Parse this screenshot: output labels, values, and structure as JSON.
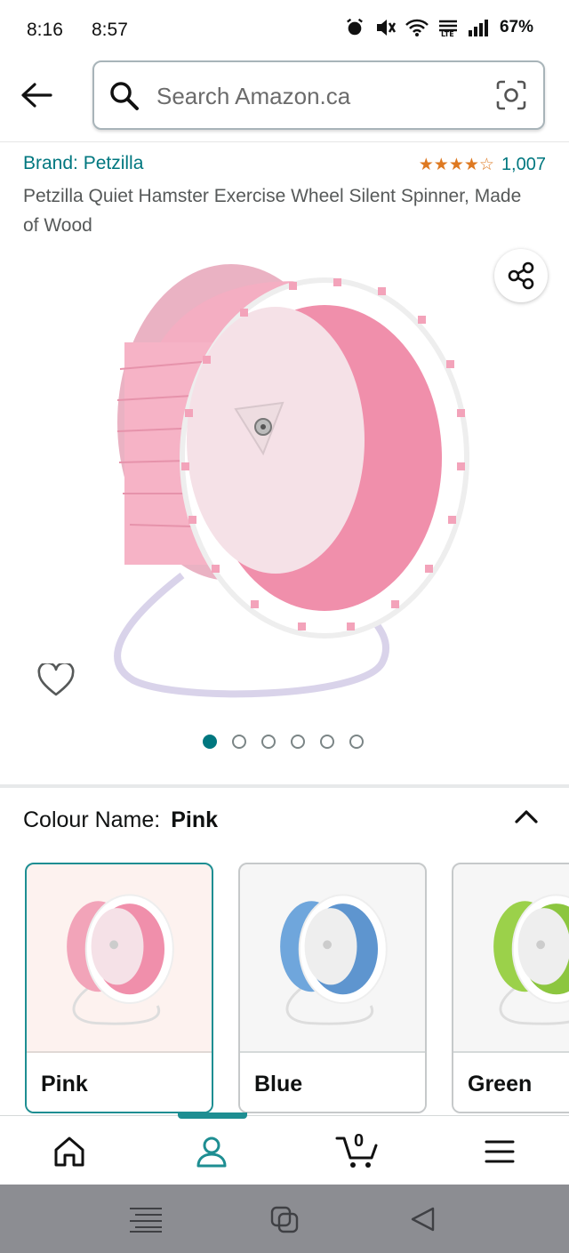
{
  "status_bar": {
    "time_primary": "8:16",
    "time_secondary": "8:57",
    "battery": "67%"
  },
  "search": {
    "placeholder": "Search Amazon.ca"
  },
  "product": {
    "brand": "Brand: Petzilla",
    "rating_stars": "★★★★☆",
    "rating_value": 4.5,
    "rating_count": "1,007",
    "title": "Petzilla Quiet Hamster Exercise Wheel Silent Spinner, Made of Wood",
    "image_count": 6,
    "active_image_index": 0
  },
  "colour": {
    "label": "Colour Name:",
    "selected": "Pink",
    "options": [
      {
        "label": "Pink",
        "color": "#f4a6bd"
      },
      {
        "label": "Blue",
        "color": "#6fa6dc"
      },
      {
        "label": "Green",
        "color": "#9bd14a"
      }
    ]
  },
  "bottom_nav": {
    "cart_count": "0",
    "active": "account"
  },
  "colors": {
    "accent": "#00777f",
    "star": "#de7921",
    "wheel_pink": "#f2a4b9",
    "system_nav": "#8c8d92"
  }
}
